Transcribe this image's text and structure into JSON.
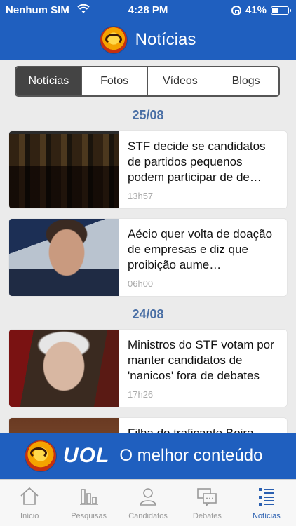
{
  "status_bar": {
    "carrier": "Nenhum SIM",
    "time": "4:28 PM",
    "battery": "41%",
    "battery_level": 0.41
  },
  "header": {
    "title": "Notícias"
  },
  "segments": [
    {
      "label": "Notícias",
      "active": true
    },
    {
      "label": "Fotos",
      "active": false
    },
    {
      "label": "Vídeos",
      "active": false
    },
    {
      "label": "Blogs",
      "active": false
    }
  ],
  "feed": {
    "groups": [
      {
        "date": "25/08",
        "items": [
          {
            "title": "STF decide se candidatos de partidos pequenos podem participar de de…",
            "time": "13h57",
            "thumb": "court"
          },
          {
            "title": "Aécio quer volta de doação de empresas e diz que proibição aume…",
            "time": "06h00",
            "thumb": "man"
          }
        ]
      },
      {
        "date": "24/08",
        "items": [
          {
            "title": "Ministros do STF votam por manter candidatos de 'nanicos' fora de debates",
            "time": "17h26",
            "thumb": "old"
          },
          {
            "title": "Filha do traficante Beira-",
            "time": "",
            "thumb": "partial"
          }
        ]
      }
    ]
  },
  "ad_banner": {
    "brand": "UOL",
    "slogan": "O melhor conteúdo"
  },
  "tab_bar": [
    {
      "label": "Início",
      "icon": "home-icon",
      "active": false
    },
    {
      "label": "Pesquisas",
      "icon": "bar-chart-icon",
      "active": false
    },
    {
      "label": "Candidatos",
      "icon": "person-icon",
      "active": false
    },
    {
      "label": "Debates",
      "icon": "chat-bubbles-icon",
      "active": false
    },
    {
      "label": "Notícias",
      "icon": "list-icon",
      "active": true
    }
  ],
  "colors": {
    "brand_blue": "#1f5fbf",
    "date_label": "#4a6fa5",
    "active_tab": "#2a5fb0"
  }
}
